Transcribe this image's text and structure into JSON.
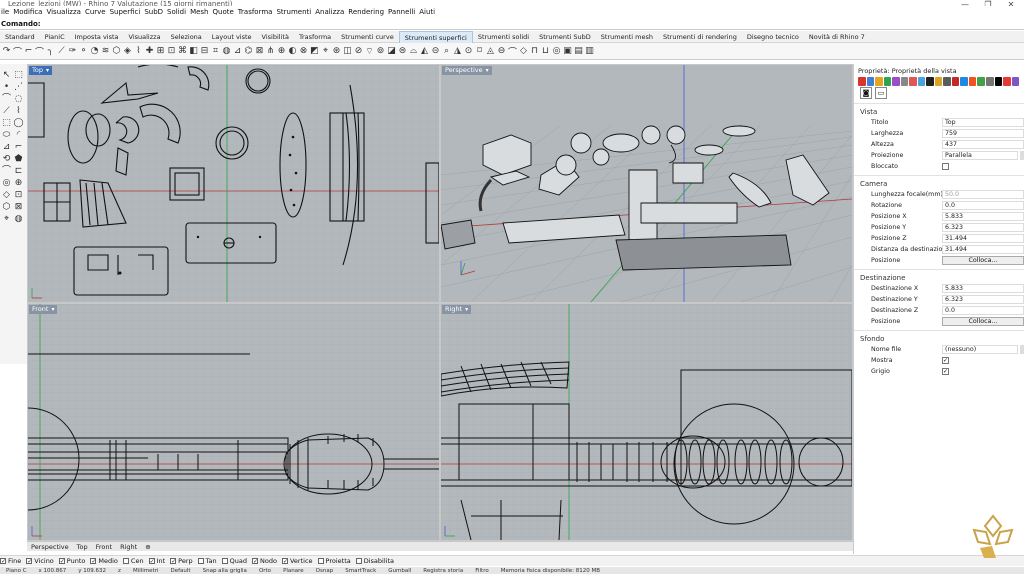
{
  "titlebar": {
    "title": "Lezione_lezioni (MW) - Rhino 7 Valutazione (15 giorni rimanenti)",
    "min": "—",
    "max": "❐",
    "close": "✕"
  },
  "menu": [
    "ile",
    "Modifica",
    "Visualizza",
    "Curve",
    "Superfici",
    "SubD",
    "Solidi",
    "Mesh",
    "Quote",
    "Trasforma",
    "Strumenti",
    "Analizza",
    "Rendering",
    "Pannelli",
    "Aiuti"
  ],
  "command": {
    "label": "Comando:",
    "value": ""
  },
  "tabs": [
    {
      "label": "Standard"
    },
    {
      "label": "PianiC"
    },
    {
      "label": "Imposta vista"
    },
    {
      "label": "Visualizza"
    },
    {
      "label": "Seleziona"
    },
    {
      "label": "Layout viste"
    },
    {
      "label": "Visibilità"
    },
    {
      "label": "Trasforma"
    },
    {
      "label": "Strumenti curve"
    },
    {
      "label": "Strumenti superfici"
    },
    {
      "label": "Strumenti solidi"
    },
    {
      "label": "Strumenti SubD"
    },
    {
      "label": "Strumenti mesh"
    },
    {
      "label": "Strumenti di rendering"
    },
    {
      "label": "Disegno tecnico"
    },
    {
      "label": "Novità di Rhino 7"
    }
  ],
  "active_tab": "Strumenti superfici",
  "viewports": {
    "top": "Top",
    "perspective": "Perspective",
    "front": "Front",
    "right": "Right"
  },
  "viewport_tabs": [
    "Perspective",
    "Top",
    "Front",
    "Right",
    "⊕"
  ],
  "osnaps": [
    {
      "label": "Fine",
      "checked": true
    },
    {
      "label": "Vicino",
      "checked": true
    },
    {
      "label": "Punto",
      "checked": true
    },
    {
      "label": "Medio",
      "checked": true
    },
    {
      "label": "Cen",
      "checked": false
    },
    {
      "label": "Int",
      "checked": true
    },
    {
      "label": "Perp",
      "checked": true
    },
    {
      "label": "Tan",
      "checked": false
    },
    {
      "label": "Quad",
      "checked": false
    },
    {
      "label": "Nodo",
      "checked": true
    },
    {
      "label": "Vertice",
      "checked": true
    },
    {
      "label": "Proietta",
      "checked": false
    },
    {
      "label": "Disabilita",
      "checked": false
    }
  ],
  "statusbar": [
    "Piano C",
    "x 100.867",
    "y 109.632",
    "z",
    "Millimetri",
    "Default",
    "Snap alla griglia",
    "Orto",
    "Planare",
    "Osnap",
    "SmartTrack",
    "Gumball",
    "Registra storia",
    "Filtro",
    "Memoria fisica disponibile: 8120 MB"
  ],
  "panel": {
    "title": "Proprietà: Proprietà della vista",
    "icon_colors": [
      "#d9342b",
      "#3f7fd6",
      "#e7a420",
      "#2ea44f",
      "#9c4dcc",
      "#888888",
      "#e05555",
      "#4aa3df",
      "#222222",
      "#d9a520",
      "#5b5b5b",
      "#c62828",
      "#1e88e5",
      "#f4511e",
      "#43a047",
      "#757575",
      "#000000",
      "#e53935",
      "#7e57c2"
    ],
    "sections": [
      {
        "title": "Vista",
        "rows": [
          {
            "label": "Titolo",
            "value": "Top",
            "kind": "text"
          },
          {
            "label": "Larghezza",
            "value": "759",
            "kind": "text"
          },
          {
            "label": "Altezza",
            "value": "437",
            "kind": "text"
          },
          {
            "label": "Proiezione",
            "value": "Parallela",
            "kind": "select"
          },
          {
            "label": "Bloccato",
            "value": "",
            "kind": "check",
            "checked": false
          }
        ]
      },
      {
        "title": "Camera",
        "rows": [
          {
            "label": "Lunghezza focale(mm)",
            "value": "50.0",
            "kind": "text",
            "dim": true
          },
          {
            "label": "Rotazione",
            "value": "0.0",
            "kind": "text"
          },
          {
            "label": "Posizione X",
            "value": "5.833",
            "kind": "text"
          },
          {
            "label": "Posizione Y",
            "value": "6.323",
            "kind": "text"
          },
          {
            "label": "Posizione Z",
            "value": "31.494",
            "kind": "text"
          },
          {
            "label": "Distanza da destinazione",
            "value": "31.494",
            "kind": "text"
          },
          {
            "label": "Posizione",
            "value": "Colloca...",
            "kind": "button"
          }
        ]
      },
      {
        "title": "Destinazione",
        "rows": [
          {
            "label": "Destinazione X",
            "value": "5.833",
            "kind": "text"
          },
          {
            "label": "Destinazione Y",
            "value": "6.323",
            "kind": "text"
          },
          {
            "label": "Destinazione Z",
            "value": "0.0",
            "kind": "text"
          },
          {
            "label": "Posizione",
            "value": "Colloca...",
            "kind": "button"
          }
        ]
      },
      {
        "title": "Sfondo",
        "rows": [
          {
            "label": "Nome file",
            "value": "(nessuno)",
            "kind": "select"
          },
          {
            "label": "Mostra",
            "value": "",
            "kind": "check",
            "checked": true
          },
          {
            "label": "Grigio",
            "value": "",
            "kind": "check",
            "checked": true
          }
        ]
      }
    ]
  },
  "colors": {
    "viewport_bg": "#b3b8bc",
    "active_title": "#3d6fb6",
    "x_axis": "#b33a3a",
    "y_axis": "#2fa34a",
    "z_axis": "#4a5bd6",
    "grid": "#a6abaf"
  }
}
